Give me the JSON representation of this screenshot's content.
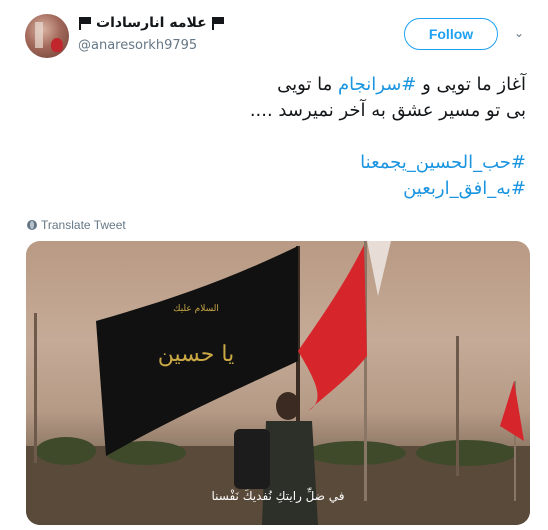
{
  "user": {
    "display_name": "علامه انارسادات",
    "handle": "@anaresorkh9795",
    "name_icon": "black-flag-icon"
  },
  "follow_button": {
    "label": "Follow"
  },
  "menu": {
    "icon": "chevron-down-icon",
    "glyph": "⌄"
  },
  "tweet": {
    "line1_pre": "آغاز ما تویی و ",
    "line1_tag": "#سرانجام",
    "line1_post": " ما تویی",
    "line2": "بی تو مسیر عشق به آخر نمیرسد ....",
    "hashtag1": "#حب_الحسین_یجمعنا",
    "hashtag2": "#به_افق_اربعین"
  },
  "translate": {
    "label": "Translate Tweet",
    "icon": "globe-icon"
  },
  "media": {
    "subtitle": "في ضلِّ رايتكِ نُفديكَ نَفْسنا",
    "banner_text": "يا حسين",
    "banner_small": "السلام عليك"
  },
  "colors": {
    "accent": "#1da1f2",
    "hashtag": "#1b95e0",
    "secondary_text": "#657786",
    "red_flag": "#d7262b",
    "black_flag": "#111111"
  }
}
